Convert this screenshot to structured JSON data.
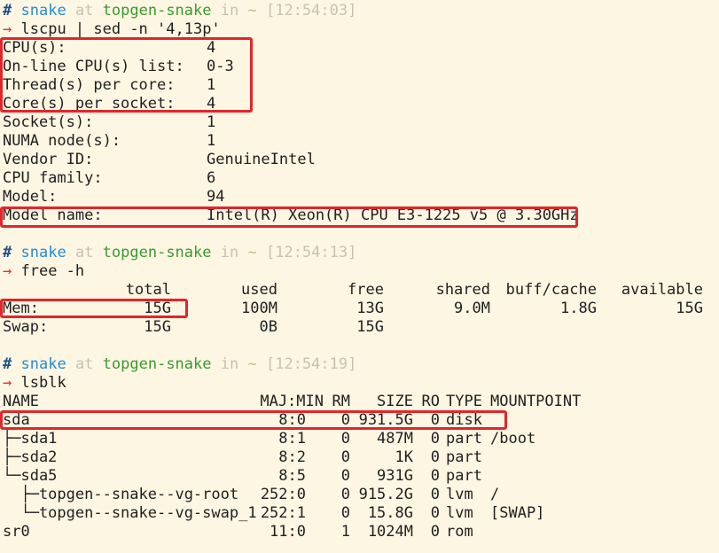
{
  "colors": {
    "background": "#fdf6e3",
    "text": "#1f1f1f",
    "prompt_user": "#268bd2",
    "prompt_host": "#3a9a2e",
    "prompt_dim": "#c7c2b3",
    "arrow": "#dc322f",
    "highlight_box": "#e1262a"
  },
  "blocks": [
    {
      "prompt": {
        "hash": "#",
        "user": "snake",
        "at": "at",
        "host": "topgen-snake",
        "in": "in",
        "dir": "~",
        "time": "[12:54:03]"
      },
      "command": {
        "arrow": "→",
        "text": "lscpu | sed -n '4,13p'"
      },
      "rows": [
        {
          "key": "CPU(s):",
          "value": "4"
        },
        {
          "key": "On-line CPU(s) list:",
          "value": "0-3"
        },
        {
          "key": "Thread(s) per core:",
          "value": "1"
        },
        {
          "key": "Core(s) per socket:",
          "value": "4"
        },
        {
          "key": "Socket(s):",
          "value": "1"
        },
        {
          "key": "NUMA node(s):",
          "value": "1"
        },
        {
          "key": "Vendor ID:",
          "value": "GenuineIntel"
        },
        {
          "key": "CPU family:",
          "value": "6"
        },
        {
          "key": "Model:",
          "value": "94"
        },
        {
          "key": "Model name:",
          "value": "Intel(R) Xeon(R) CPU E3-1225 v5 @ 3.30GHz"
        }
      ]
    },
    {
      "prompt": {
        "hash": "#",
        "user": "snake",
        "at": "at",
        "host": "topgen-snake",
        "in": "in",
        "dir": "~",
        "time": "[12:54:13]"
      },
      "command": {
        "arrow": "→",
        "text": "free -h"
      },
      "header": [
        "total",
        "used",
        "free",
        "shared",
        "buff/cache",
        "available"
      ],
      "rows": [
        {
          "label": "Mem:",
          "cells": [
            "15G",
            "100M",
            "13G",
            "9.0M",
            "1.8G",
            "15G"
          ]
        },
        {
          "label": "Swap:",
          "cells": [
            "15G",
            "0B",
            "15G",
            "",
            "",
            ""
          ]
        }
      ]
    },
    {
      "prompt": {
        "hash": "#",
        "user": "snake",
        "at": "at",
        "host": "topgen-snake",
        "in": "in",
        "dir": "~",
        "time": "[12:54:19]"
      },
      "command": {
        "arrow": "→",
        "text": "lsblk"
      },
      "header": {
        "name": "NAME",
        "majmin": "MAJ:MIN",
        "rm": "RM",
        "size": "SIZE",
        "ro": "RO",
        "type": "TYPE",
        "mount": "MOUNTPOINT"
      },
      "rows": [
        {
          "name": "sda",
          "majmin": "8:0",
          "rm": "0",
          "size": "931.5G",
          "ro": "0",
          "type": "disk",
          "mount": ""
        },
        {
          "name": "├─sda1",
          "majmin": "8:1",
          "rm": "0",
          "size": "487M",
          "ro": "0",
          "type": "part",
          "mount": "/boot"
        },
        {
          "name": "├─sda2",
          "majmin": "8:2",
          "rm": "0",
          "size": "1K",
          "ro": "0",
          "type": "part",
          "mount": ""
        },
        {
          "name": "└─sda5",
          "majmin": "8:5",
          "rm": "0",
          "size": "931G",
          "ro": "0",
          "type": "part",
          "mount": ""
        },
        {
          "name": "  ├─topgen--snake--vg-root",
          "majmin": "252:0",
          "rm": "0",
          "size": "915.2G",
          "ro": "0",
          "type": "lvm",
          "mount": "/"
        },
        {
          "name": "  └─topgen--snake--vg-swap_1",
          "majmin": "252:1",
          "rm": "0",
          "size": "15.8G",
          "ro": "0",
          "type": "lvm",
          "mount": "[SWAP]"
        },
        {
          "name": "sr0",
          "majmin": "11:0",
          "rm": "1",
          "size": "1024M",
          "ro": "0",
          "type": "rom",
          "mount": ""
        }
      ]
    }
  ]
}
